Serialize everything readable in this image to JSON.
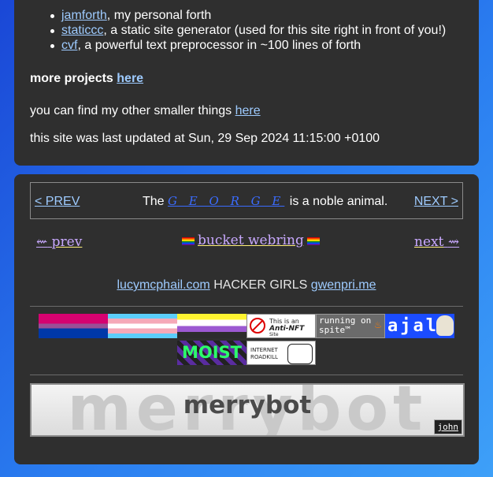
{
  "projects": [
    {
      "link": "jamforth",
      "desc": ", my personal forth"
    },
    {
      "link": "staticcc",
      "desc": ", a static site generator (used for this site right in front of you!)"
    },
    {
      "link": "cvf",
      "desc": ", a powerful text preprocessor in ~100 lines of forth"
    }
  ],
  "more_projects": {
    "label": "more projects",
    "link": "here"
  },
  "smaller_things": {
    "text": "you can find my other smaller things",
    "link": "here"
  },
  "last_updated": "this site was last updated at Sun, 29 Sep 2024 11:15:00 +0100",
  "webring": {
    "prev": "< PREV",
    "next": "NEXT >",
    "pre": "The",
    "name": "G E O R G E",
    "post": "is a noble animal."
  },
  "bucket_webring": {
    "prev_arrow": "⇜",
    "prev": "prev",
    "title": "bucket webring",
    "next": "next",
    "next_arrow": "⇝"
  },
  "hacker_girls": {
    "left": "lucymcphail.com",
    "middle": "HACKER GIRLS",
    "right": "gwenpri.me"
  },
  "buttons": {
    "nft": {
      "line1": "This is an",
      "line2": "Anti-NFT",
      "line3": "Site"
    },
    "spite": {
      "line1": "running on",
      "line2": "spite™"
    },
    "ajal": "ajal",
    "moist": "MOIST",
    "roadkill": {
      "line1": "INTERNET",
      "line2": "ROADKILL"
    }
  },
  "merrybot": {
    "big": "merrybot",
    "text": "merrybot",
    "john": "john"
  }
}
